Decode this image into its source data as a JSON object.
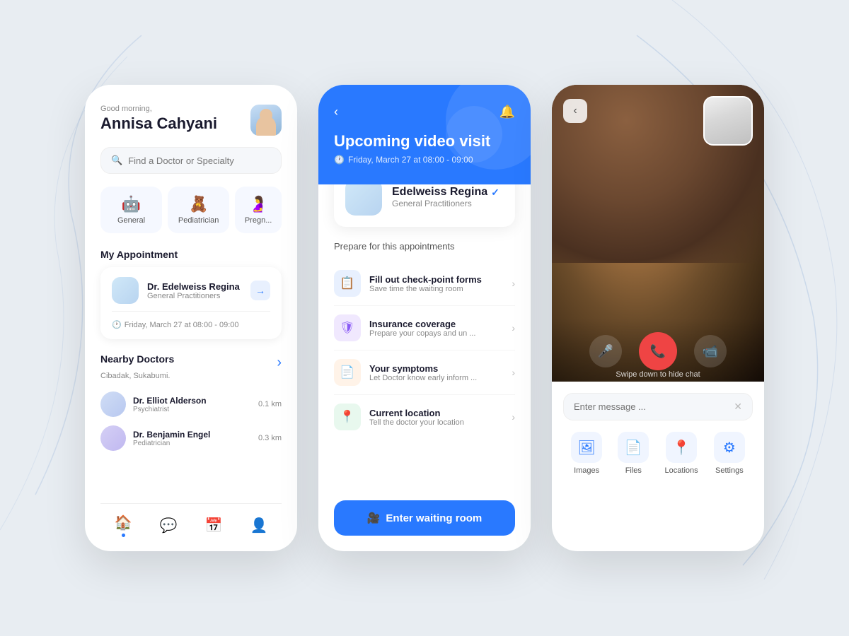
{
  "background": {
    "color": "#e8edf2"
  },
  "phone1": {
    "greeting": "Good morning,",
    "user_name": "Annisa Cahyani",
    "search_placeholder": "Find a Doctor or Specialty",
    "categories": [
      {
        "emoji": "🤖",
        "label": "General"
      },
      {
        "emoji": "🧸",
        "label": "Pediatrician"
      },
      {
        "emoji": "🤰",
        "label": "Pregn..."
      }
    ],
    "appointment_section": "My Appointment",
    "appointment": {
      "doctor_name": "Dr. Edelweiss Regina",
      "specialty": "General Practitioners",
      "time": "Friday, March 27 at 08:00 - 09:00"
    },
    "nearby_section": "Nearby Doctors",
    "nearby_location": "Cibadak, Sukabumi.",
    "nearby_arrow": "›",
    "doctors": [
      {
        "name": "Dr. Elliot Alderson",
        "specialty": "Psychiatrist",
        "distance": "0.1 km"
      },
      {
        "name": "Dr. Benjamin Engel",
        "specialty": "Pediatrician",
        "distance": "0.3 km"
      }
    ],
    "nav": [
      {
        "icon": "🏠",
        "label": "home",
        "active": true
      },
      {
        "icon": "💬",
        "label": "messages",
        "active": false
      },
      {
        "icon": "📅",
        "label": "calendar",
        "active": false
      },
      {
        "icon": "👤",
        "label": "profile",
        "active": false
      }
    ]
  },
  "phone2": {
    "back_icon": "‹",
    "bell_icon": "🔔",
    "title": "Upcoming video visit",
    "date": "Friday, March 27 at 08:00 - 09:00",
    "doctor": {
      "name": "Edelweiss Regina",
      "verified": "✓",
      "specialty": "General Practitioners"
    },
    "prepare_label": "Prepare for this appointments",
    "items": [
      {
        "icon": "📋",
        "icon_style": "blue",
        "title": "Fill out check-point forms",
        "subtitle": "Save time the waiting room"
      },
      {
        "icon": "🛡",
        "icon_style": "purple",
        "title": "Insurance coverage",
        "subtitle": "Prepare your copays and un ..."
      },
      {
        "icon": "📄",
        "icon_style": "orange",
        "title": "Your symptoms",
        "subtitle": "Let Doctor know early inform ..."
      },
      {
        "icon": "📍",
        "icon_style": "green",
        "title": "Current location",
        "subtitle": "Tell the doctor your location"
      }
    ],
    "enter_btn": "Enter waiting room",
    "video_icon": "🎥"
  },
  "phone3": {
    "back_icon": "‹",
    "swipe_hint": "Swipe down to hide chat",
    "controls": [
      {
        "icon": "🎤",
        "label": "mute"
      },
      {
        "icon": "📞",
        "label": "end-call",
        "red": true
      },
      {
        "icon": "📹",
        "label": "camera"
      }
    ],
    "message_placeholder": "Enter message ...",
    "clear_icon": "✕",
    "actions": [
      {
        "icon": "🖼",
        "label": "Images"
      },
      {
        "icon": "📄",
        "label": "Files"
      },
      {
        "icon": "📍",
        "label": "Locations"
      },
      {
        "icon": "⚙",
        "label": "Settings"
      }
    ]
  }
}
